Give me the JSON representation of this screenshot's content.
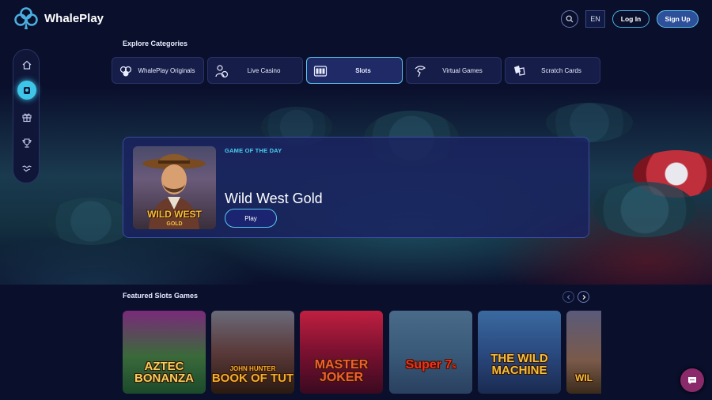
{
  "header": {
    "brand": "WhalePlay",
    "logo_icon": "whaleplay-logo-icon",
    "language": "EN",
    "login_label": "Log In",
    "signup_label": "Sign Up"
  },
  "sidebar": {
    "items": [
      {
        "icon": "home-icon",
        "active": false
      },
      {
        "icon": "slots-hand-icon",
        "active": true
      },
      {
        "icon": "gift-icon",
        "active": false
      },
      {
        "icon": "trophy-icon",
        "active": false
      },
      {
        "icon": "handshake-icon",
        "active": false
      }
    ]
  },
  "categories": {
    "title": "Explore Categories",
    "items": [
      {
        "label": "WhalePlay Originals",
        "icon": "originals-icon",
        "active": false
      },
      {
        "label": "Live Casino",
        "icon": "live-casino-icon",
        "active": false
      },
      {
        "label": "Slots",
        "icon": "slots-icon",
        "active": true
      },
      {
        "label": "Virtual Games",
        "icon": "virtual-games-icon",
        "active": false
      },
      {
        "label": "Scratch Cards",
        "icon": "scratch-cards-icon",
        "active": false
      }
    ]
  },
  "game_of_the_day": {
    "kicker": "GAME OF THE DAY",
    "title": "Wild West Gold",
    "play_label": "Play",
    "thumb_text": "WILD WEST",
    "thumb_subtext": "GOLD"
  },
  "featured": {
    "title": "Featured Slots Games",
    "games": [
      {
        "line1": "AZTEC",
        "line2": "BONANZA"
      },
      {
        "line1": "JOHN HUNTER",
        "line2": "BOOK OF TUT"
      },
      {
        "line1": "MASTER",
        "line2": "JOKER"
      },
      {
        "line1": "Super 7",
        "line2": "s"
      },
      {
        "line1": "THE WILD",
        "line2": "MACHINE"
      },
      {
        "line1": "WIL",
        "line2": ""
      }
    ]
  },
  "colors": {
    "background": "#0a0f2c",
    "accent": "#5ac8f0",
    "kicker": "#4ad0f0",
    "chat": "#8a2a6a"
  }
}
